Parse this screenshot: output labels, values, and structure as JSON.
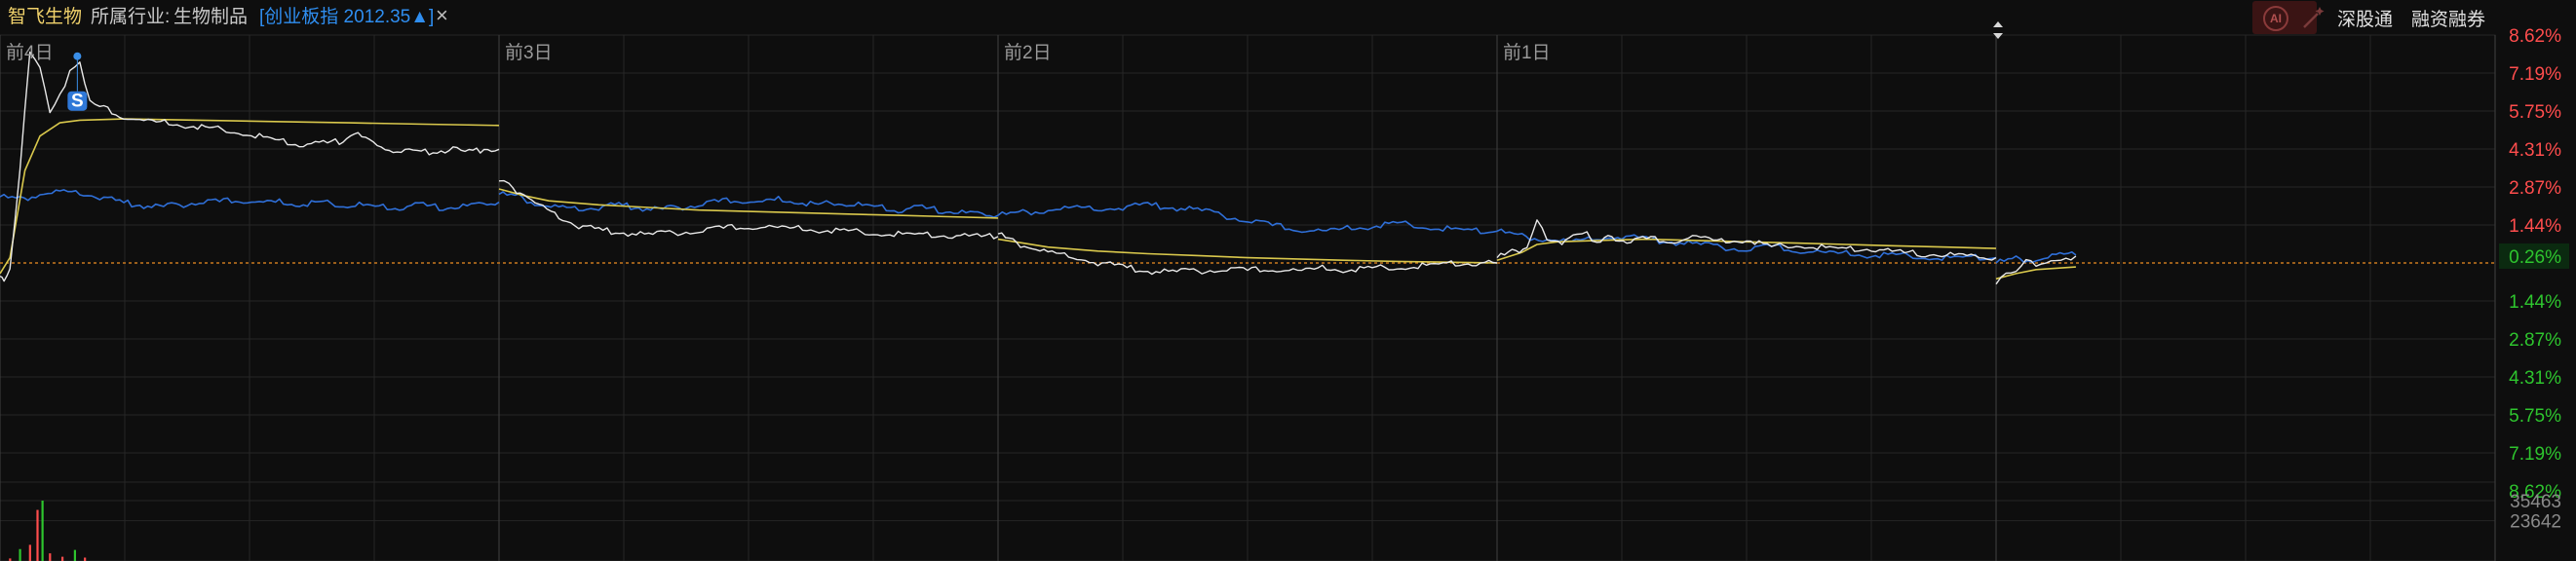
{
  "header": {
    "stock_name": "智飞生物",
    "industry_label": "所属行业:",
    "industry_value": "生物制品",
    "index_chip": "[创业板指 2012.35▲]",
    "close_symbol": "×",
    "ai_label": "AI",
    "buttons": [
      {
        "label": "深股通"
      },
      {
        "label": "融资融券"
      }
    ]
  },
  "colors": {
    "background": "#0e0e0e",
    "grid": "#262626",
    "price_line": "#e8e8e8",
    "avg_line": "#d9c84c",
    "index_line": "#2f6fd8",
    "up": "#ff4d4d",
    "down": "#2ec52e",
    "baseline": "#c8781e",
    "header_name": "#f1d26b"
  },
  "chart_data": {
    "type": "line",
    "x_labels": [
      "前4日",
      "前3日",
      "前2日",
      "前1日"
    ],
    "current_change_label": "0.26%",
    "current_change_pct": 0.26,
    "marker_label": "S",
    "y_ticks_up": [
      "8.62%",
      "7.19%",
      "5.75%",
      "4.31%",
      "2.87%",
      "1.44%"
    ],
    "y_ticks_down": [
      "1.44%",
      "2.87%",
      "4.31%",
      "5.75%",
      "7.19%",
      "8.62%"
    ],
    "ylim": [
      -8.62,
      8.62
    ],
    "volume_ticks": [
      "35463",
      "23642"
    ],
    "volume_ylim": [
      0,
      35463
    ],
    "days": [
      {
        "price": [
          [
            0,
            -0.5
          ],
          [
            0.008,
            -0.8
          ],
          [
            0.02,
            -0.2
          ],
          [
            0.04,
            3.5
          ],
          [
            0.06,
            8.0
          ],
          [
            0.08,
            7.5
          ],
          [
            0.1,
            5.6
          ],
          [
            0.12,
            6.4
          ],
          [
            0.14,
            7.2
          ],
          [
            0.16,
            7.6
          ],
          [
            0.18,
            6.2
          ],
          [
            0.2,
            5.9
          ],
          [
            0.24,
            5.6
          ],
          [
            0.28,
            5.4
          ],
          [
            0.33,
            5.3
          ],
          [
            0.38,
            5.2
          ],
          [
            0.42,
            5.1
          ],
          [
            0.47,
            5.0
          ],
          [
            0.52,
            4.8
          ],
          [
            0.56,
            4.6
          ],
          [
            0.6,
            4.5
          ],
          [
            0.64,
            4.5
          ],
          [
            0.68,
            4.6
          ],
          [
            0.71,
            4.9
          ],
          [
            0.74,
            4.6
          ],
          [
            0.78,
            4.3
          ],
          [
            0.82,
            4.2
          ],
          [
            0.86,
            4.2
          ],
          [
            0.9,
            4.3
          ],
          [
            0.94,
            4.2
          ],
          [
            0.97,
            4.3
          ],
          [
            1.0,
            4.3
          ]
        ],
        "avg": [
          [
            0,
            -0.4
          ],
          [
            0.02,
            0.2
          ],
          [
            0.05,
            3.5
          ],
          [
            0.08,
            4.8
          ],
          [
            0.12,
            5.3
          ],
          [
            0.16,
            5.4
          ],
          [
            0.25,
            5.45
          ],
          [
            0.4,
            5.4
          ],
          [
            0.55,
            5.35
          ],
          [
            0.7,
            5.3
          ],
          [
            0.85,
            5.25
          ],
          [
            1.0,
            5.2
          ]
        ],
        "index": [
          [
            0,
            2.5
          ],
          [
            0.04,
            2.4
          ],
          [
            0.08,
            2.6
          ],
          [
            0.12,
            2.7
          ],
          [
            0.16,
            2.6
          ],
          [
            0.2,
            2.5
          ],
          [
            0.24,
            2.3
          ],
          [
            0.28,
            2.2
          ],
          [
            0.32,
            2.1
          ],
          [
            0.36,
            2.2
          ],
          [
            0.4,
            2.3
          ],
          [
            0.44,
            2.3
          ],
          [
            0.48,
            2.4
          ],
          [
            0.52,
            2.3
          ],
          [
            0.56,
            2.3
          ],
          [
            0.6,
            2.2
          ],
          [
            0.64,
            2.3
          ],
          [
            0.68,
            2.2
          ],
          [
            0.72,
            2.2
          ],
          [
            0.76,
            2.1
          ],
          [
            0.8,
            2.1
          ],
          [
            0.84,
            2.2
          ],
          [
            0.88,
            2.1
          ],
          [
            0.92,
            2.1
          ],
          [
            0.96,
            2.2
          ],
          [
            1.0,
            2.3
          ]
        ],
        "volume": [
          [
            0.02,
            1500
          ],
          [
            0.04,
            7000
          ],
          [
            0.06,
            9500
          ],
          [
            0.075,
            30000
          ],
          [
            0.085,
            35463
          ],
          [
            0.1,
            4500
          ],
          [
            0.125,
            2500
          ],
          [
            0.15,
            6500
          ],
          [
            0.17,
            2000
          ]
        ]
      },
      {
        "price": [
          [
            0,
            3.1
          ],
          [
            0.02,
            2.9
          ],
          [
            0.05,
            2.6
          ],
          [
            0.08,
            2.2
          ],
          [
            0.12,
            1.7
          ],
          [
            0.16,
            1.4
          ],
          [
            0.2,
            1.25
          ],
          [
            0.25,
            1.15
          ],
          [
            0.3,
            1.05
          ],
          [
            0.35,
            1.15
          ],
          [
            0.4,
            1.2
          ],
          [
            0.45,
            1.3
          ],
          [
            0.5,
            1.4
          ],
          [
            0.55,
            1.35
          ],
          [
            0.6,
            1.3
          ],
          [
            0.65,
            1.25
          ],
          [
            0.7,
            1.2
          ],
          [
            0.75,
            1.15
          ],
          [
            0.8,
            1.1
          ],
          [
            0.85,
            1.05
          ],
          [
            0.9,
            1.05
          ],
          [
            0.95,
            1.0
          ],
          [
            1.0,
            1.0
          ]
        ],
        "avg": [
          [
            0,
            2.8
          ],
          [
            0.05,
            2.55
          ],
          [
            0.1,
            2.35
          ],
          [
            0.2,
            2.2
          ],
          [
            0.3,
            2.1
          ],
          [
            0.4,
            2.0
          ],
          [
            0.5,
            1.95
          ],
          [
            0.6,
            1.9
          ],
          [
            0.7,
            1.85
          ],
          [
            0.8,
            1.8
          ],
          [
            0.9,
            1.75
          ],
          [
            1.0,
            1.7
          ]
        ],
        "index": [
          [
            0,
            2.6
          ],
          [
            0.04,
            2.5
          ],
          [
            0.08,
            2.2
          ],
          [
            0.12,
            2.1
          ],
          [
            0.16,
            2.0
          ],
          [
            0.2,
            2.1
          ],
          [
            0.24,
            2.2
          ],
          [
            0.28,
            2.1
          ],
          [
            0.32,
            2.0
          ],
          [
            0.36,
            2.1
          ],
          [
            0.4,
            2.2
          ],
          [
            0.44,
            2.3
          ],
          [
            0.48,
            2.4
          ],
          [
            0.52,
            2.3
          ],
          [
            0.56,
            2.4
          ],
          [
            0.6,
            2.3
          ],
          [
            0.64,
            2.2
          ],
          [
            0.68,
            2.3
          ],
          [
            0.72,
            2.2
          ],
          [
            0.76,
            2.1
          ],
          [
            0.8,
            2.0
          ],
          [
            0.84,
            2.1
          ],
          [
            0.88,
            2.0
          ],
          [
            0.92,
            1.9
          ],
          [
            0.96,
            1.85
          ],
          [
            1.0,
            1.8
          ]
        ],
        "volume": []
      },
      {
        "price": [
          [
            0,
            1.1
          ],
          [
            0.03,
            0.8
          ],
          [
            0.06,
            0.6
          ],
          [
            0.1,
            0.4
          ],
          [
            0.15,
            0.2
          ],
          [
            0.2,
            0.0
          ],
          [
            0.25,
            -0.15
          ],
          [
            0.3,
            -0.3
          ],
          [
            0.35,
            -0.35
          ],
          [
            0.4,
            -0.3
          ],
          [
            0.45,
            -0.25
          ],
          [
            0.5,
            -0.3
          ],
          [
            0.55,
            -0.2
          ],
          [
            0.6,
            -0.3
          ],
          [
            0.65,
            -0.2
          ],
          [
            0.7,
            -0.25
          ],
          [
            0.75,
            -0.2
          ],
          [
            0.8,
            -0.15
          ],
          [
            0.85,
            -0.1
          ],
          [
            0.9,
            -0.05
          ],
          [
            0.95,
            0.0
          ],
          [
            1.0,
            0.0
          ]
        ],
        "avg": [
          [
            0,
            0.9
          ],
          [
            0.05,
            0.75
          ],
          [
            0.1,
            0.6
          ],
          [
            0.2,
            0.45
          ],
          [
            0.3,
            0.35
          ],
          [
            0.4,
            0.28
          ],
          [
            0.5,
            0.2
          ],
          [
            0.6,
            0.15
          ],
          [
            0.7,
            0.1
          ],
          [
            0.8,
            0.06
          ],
          [
            0.9,
            0.03
          ],
          [
            1.0,
            0.0
          ]
        ],
        "index": [
          [
            0,
            1.8
          ],
          [
            0.05,
            1.9
          ],
          [
            0.1,
            2.0
          ],
          [
            0.15,
            2.1
          ],
          [
            0.2,
            2.0
          ],
          [
            0.25,
            2.1
          ],
          [
            0.3,
            2.2
          ],
          [
            0.35,
            2.1
          ],
          [
            0.4,
            2.0
          ],
          [
            0.45,
            1.8
          ],
          [
            0.5,
            1.6
          ],
          [
            0.55,
            1.4
          ],
          [
            0.6,
            1.3
          ],
          [
            0.65,
            1.2
          ],
          [
            0.7,
            1.3
          ],
          [
            0.75,
            1.4
          ],
          [
            0.8,
            1.5
          ],
          [
            0.85,
            1.4
          ],
          [
            0.9,
            1.3
          ],
          [
            0.95,
            1.2
          ],
          [
            1.0,
            1.2
          ]
        ],
        "volume": []
      },
      {
        "price": [
          [
            0,
            0.2
          ],
          [
            0.03,
            0.4
          ],
          [
            0.06,
            0.6
          ],
          [
            0.08,
            1.6
          ],
          [
            0.1,
            0.9
          ],
          [
            0.13,
            0.8
          ],
          [
            0.16,
            1.0
          ],
          [
            0.18,
            1.2
          ],
          [
            0.2,
            0.7
          ],
          [
            0.23,
            1.0
          ],
          [
            0.26,
            0.8
          ],
          [
            0.3,
            0.9
          ],
          [
            0.35,
            0.85
          ],
          [
            0.4,
            1.0
          ],
          [
            0.45,
            0.8
          ],
          [
            0.5,
            0.9
          ],
          [
            0.55,
            0.6
          ],
          [
            0.6,
            0.7
          ],
          [
            0.65,
            0.6
          ],
          [
            0.7,
            0.5
          ],
          [
            0.75,
            0.55
          ],
          [
            0.8,
            0.4
          ],
          [
            0.85,
            0.35
          ],
          [
            0.9,
            0.3
          ],
          [
            0.95,
            0.25
          ],
          [
            1.0,
            0.2
          ]
        ],
        "avg": [
          [
            0,
            0.1
          ],
          [
            0.05,
            0.4
          ],
          [
            0.08,
            0.7
          ],
          [
            0.12,
            0.8
          ],
          [
            0.2,
            0.85
          ],
          [
            0.3,
            0.9
          ],
          [
            0.4,
            0.85
          ],
          [
            0.5,
            0.8
          ],
          [
            0.6,
            0.75
          ],
          [
            0.7,
            0.7
          ],
          [
            0.8,
            0.65
          ],
          [
            0.9,
            0.6
          ],
          [
            1.0,
            0.55
          ]
        ],
        "index": [
          [
            0,
            1.2
          ],
          [
            0.05,
            1.0
          ],
          [
            0.1,
            0.9
          ],
          [
            0.15,
            0.8
          ],
          [
            0.2,
            0.9
          ],
          [
            0.25,
            1.0
          ],
          [
            0.3,
            0.9
          ],
          [
            0.35,
            0.8
          ],
          [
            0.4,
            0.7
          ],
          [
            0.45,
            0.6
          ],
          [
            0.5,
            0.5
          ],
          [
            0.55,
            0.6
          ],
          [
            0.6,
            0.5
          ],
          [
            0.65,
            0.4
          ],
          [
            0.7,
            0.35
          ],
          [
            0.75,
            0.3
          ],
          [
            0.8,
            0.3
          ],
          [
            0.85,
            0.25
          ],
          [
            0.9,
            0.2
          ],
          [
            0.95,
            0.2
          ],
          [
            1.0,
            0.2
          ]
        ],
        "volume": []
      },
      {
        "price": [
          [
            0,
            -0.8
          ],
          [
            0.02,
            -0.5
          ],
          [
            0.04,
            -0.3
          ],
          [
            0.06,
            0.1
          ],
          [
            0.08,
            -0.1
          ],
          [
            0.1,
            0.1
          ],
          [
            0.12,
            0.0
          ],
          [
            0.14,
            0.2
          ],
          [
            0.16,
            0.26
          ]
        ],
        "avg": [
          [
            0,
            -0.6
          ],
          [
            0.04,
            -0.4
          ],
          [
            0.08,
            -0.25
          ],
          [
            0.12,
            -0.2
          ],
          [
            0.16,
            -0.15
          ]
        ],
        "index": [
          [
            0,
            0.0
          ],
          [
            0.04,
            0.15
          ],
          [
            0.08,
            0.1
          ],
          [
            0.12,
            0.3
          ],
          [
            0.16,
            0.3
          ]
        ],
        "volume": []
      }
    ]
  }
}
